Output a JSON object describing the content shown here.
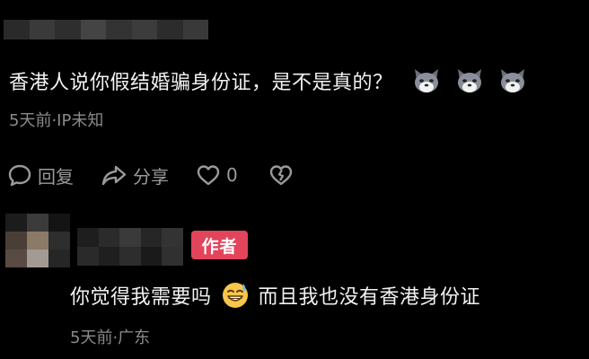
{
  "comment": {
    "text": "香港人说你假结婚骗身份证，是不是真的？",
    "emoji": [
      "wolf-face-icon",
      "wolf-face-icon",
      "wolf-face-icon"
    ],
    "meta": "5天前·IP未知",
    "actions": {
      "reply_label": "回复",
      "share_label": "分享",
      "like_count": "0"
    }
  },
  "reply": {
    "badge": "作者",
    "text_before": "你觉得我需要吗",
    "emoji": "sweat-smile-icon",
    "text_after": "而且我也没有香港身份证",
    "meta": "5天前·广东"
  },
  "colors": {
    "background": "#000000",
    "text": "#f2f2f2",
    "meta": "#8a8a8a",
    "badge": "#e2445c"
  }
}
